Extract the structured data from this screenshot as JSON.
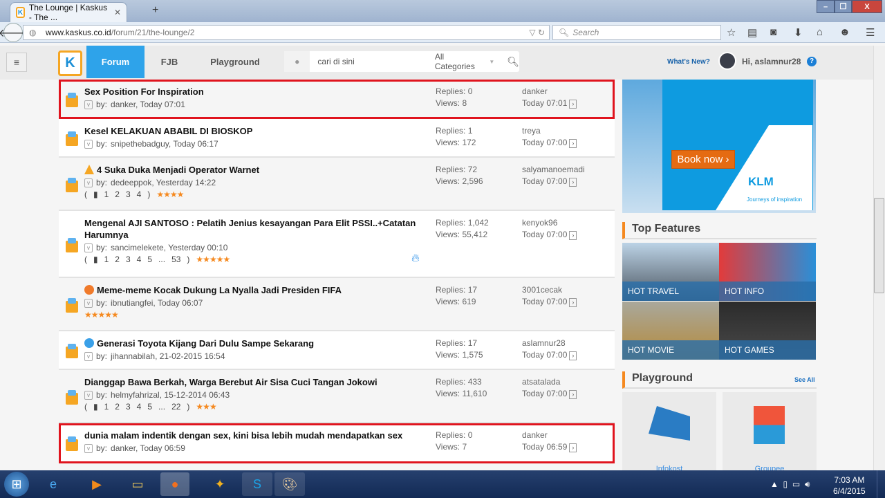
{
  "browser": {
    "tab_title": "The Lounge | Kaskus - The ...",
    "url_host": "www.kaskus.co.id",
    "url_path": "/forum/21/the-lounge/2",
    "search_placeholder": "Search"
  },
  "site": {
    "logo": "K",
    "nav": [
      "Forum",
      "FJB",
      "Playground"
    ],
    "active_nav": "Forum",
    "search_placeholder": "cari di sini",
    "category": "All Categories",
    "whats_new": "What's New?",
    "greeting": "Hi, aslamnur28",
    "help": "?"
  },
  "threads": [
    {
      "title": "Sex Position For Inspiration",
      "by": "danker",
      "date": "Today 07:01",
      "replies": "Replies: 0",
      "views": "Views: 8",
      "last_user": "danker",
      "last_time": "Today 07:01",
      "highlighted": true
    },
    {
      "title": "Kesel KELAKUAN ABABIL DI BIOSKOP",
      "by": "snipethebadguy",
      "date": "Today 06:17",
      "replies": "Replies: 1",
      "views": "Views: 172",
      "last_user": "treya",
      "last_time": "Today 07:00"
    },
    {
      "title": "4 Suka Duka Menjadi Operator Warnet",
      "icon": "warning-icon",
      "by": "dedeeppok",
      "date": "Yesterday 14:22",
      "pages": [
        "1",
        "2",
        "3",
        "4"
      ],
      "rating": 4,
      "replies": "Replies: 72",
      "views": "Views: 2,596",
      "last_user": "salyamanoemadi",
      "last_time": "Today 07:00"
    },
    {
      "title": "Mengenal AJI SANTOSO : Pelatih Jenius kesayangan Para Elit PSSI..+Catatan Harumnya",
      "by": "sancimelekete",
      "date": "Yesterday 00:10",
      "pages": [
        "1",
        "2",
        "3",
        "4",
        "5",
        "...",
        "53"
      ],
      "rating": 5,
      "hot": true,
      "replies": "Replies: 1,042",
      "views": "Views: 55,412",
      "last_user": "kenyok96",
      "last_time": "Today 07:00"
    },
    {
      "title": "Meme-meme Kocak Dukung La Nyalla Jadi Presiden FIFA",
      "icon": "laugh-emoji-icon",
      "by": "ibnutiangfei",
      "date": "Today 06:07",
      "rating": 5,
      "replies": "Replies: 17",
      "views": "Views: 619",
      "last_user": "3001cecak",
      "last_time": "Today 07:00"
    },
    {
      "title": "Generasi Toyota Kijang Dari Dulu Sampe Sekarang",
      "icon": "cool-emoji-icon",
      "by": "jihannabilah",
      "date": "21-02-2015 16:54",
      "replies": "Replies: 17",
      "views": "Views: 1,575",
      "last_user": "aslamnur28",
      "last_time": "Today 07:00"
    },
    {
      "title": "Dianggap Bawa Berkah, Warga Berebut Air Sisa Cuci Tangan Jokowi",
      "by": "helmyfahrizal",
      "date": "15-12-2014 06:43",
      "pages": [
        "1",
        "2",
        "3",
        "4",
        "5",
        "...",
        "22"
      ],
      "rating": 3,
      "replies": "Replies: 433",
      "views": "Views: 11,610",
      "last_user": "atsatalada",
      "last_time": "Today 07:00"
    },
    {
      "title": "dunia malam indentik dengan sex, kini bisa lebih mudah mendapatkan sex",
      "by": "danker",
      "date": "Today 06:59",
      "replies": "Replies: 0",
      "views": "Views: 7",
      "last_user": "danker",
      "last_time": "Today 06:59",
      "highlighted": true
    }
  ],
  "by_label": "by:",
  "ad": {
    "button": "Book now",
    "brand": "KLM",
    "tagline": "Journeys of inspiration"
  },
  "top_features": {
    "title": "Top Features",
    "tiles": [
      "HOT TRAVEL",
      "HOT INFO",
      "HOT MOVIE",
      "HOT GAMES"
    ]
  },
  "playground": {
    "title": "Playground",
    "see_all": "See All",
    "items": [
      "Infokost",
      "Groupee"
    ]
  },
  "taskbar": {
    "time": "7:03 AM",
    "date": "6/4/2015"
  },
  "colors": {
    "brand_blue": "#1b8fd6",
    "highlight_red": "#e0141e",
    "star_orange": "#f5891f"
  }
}
